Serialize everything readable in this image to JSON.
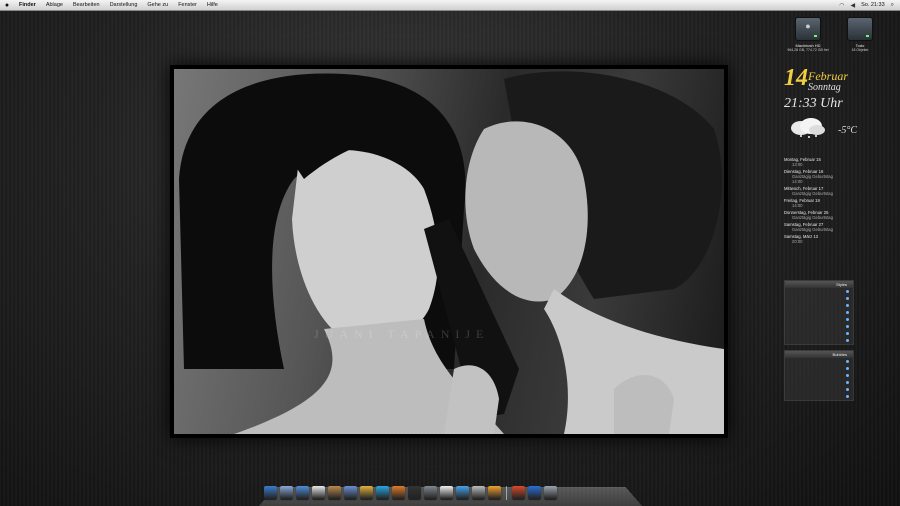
{
  "menubar": {
    "items": [
      "Finder",
      "Ablage",
      "Bearbeiten",
      "Darstellung",
      "Gehe zu",
      "Fenster",
      "Hilfe"
    ],
    "clock": "So. 21:33"
  },
  "photo": {
    "watermark": "JUANI TAPANIJE"
  },
  "drives": [
    {
      "name": "Macintosh HD",
      "info": "964,28 GB, 774,72 GB frei"
    },
    {
      "name": "Todo",
      "info": "18 Objekte"
    }
  ],
  "date_widget": {
    "day": "14",
    "month": "Februar",
    "weekday": "Sonntag",
    "time": "21:33 Uhr",
    "temperature": "-5°C",
    "weather_icon": "snow-cloud-icon"
  },
  "calendar": [
    {
      "date": "Montag, Februar 15",
      "events": [
        "13:00"
      ]
    },
    {
      "date": "Dienstag, Februar 16",
      "events": [
        "Ganztägig   Geburtstag",
        "14:00"
      ]
    },
    {
      "date": "Mittwoch, Februar 17",
      "events": [
        "Ganztägig   Geburtstag"
      ]
    },
    {
      "date": "Freitag, Februar 19",
      "events": [
        "14:00"
      ]
    },
    {
      "date": "Donnerstag, Februar 25",
      "events": [
        "Ganztägig   Geburtstag"
      ]
    },
    {
      "date": "Samstag, Februar 27",
      "events": [
        "Ganztägig   Geburtstag"
      ]
    },
    {
      "date": "Samstag, März 13",
      "events": [
        "20:00"
      ]
    }
  ],
  "lists": [
    {
      "title": "Styles",
      "rows": 8
    },
    {
      "title": "Bubbles",
      "rows": 6
    }
  ],
  "dock": {
    "icons": [
      "finder-icon",
      "mail-icon",
      "safari-icon",
      "ical-icon",
      "iphoto-icon",
      "itunes-icon",
      "ichat-icon",
      "skype-icon",
      "firefox-icon",
      "terminal-icon",
      "preferences-icon",
      "textedit-icon",
      "itunes-store-icon",
      "calculator-icon",
      "pages-icon",
      "keynote-icon",
      "appstore-icon",
      "trash-icon"
    ],
    "colors": [
      "#3b7bd0",
      "#8aa7d6",
      "#4e8ed8",
      "#e8e8e8",
      "#b98a4f",
      "#6c8fd4",
      "#e0b040",
      "#2aa6e4",
      "#e07a28",
      "#333333",
      "#808890",
      "#f0f0f0",
      "#4aa3e8",
      "#bcbcbc",
      "#f0a030",
      "#d84a2a",
      "#2a6fd8",
      "#9aa4ae"
    ]
  }
}
